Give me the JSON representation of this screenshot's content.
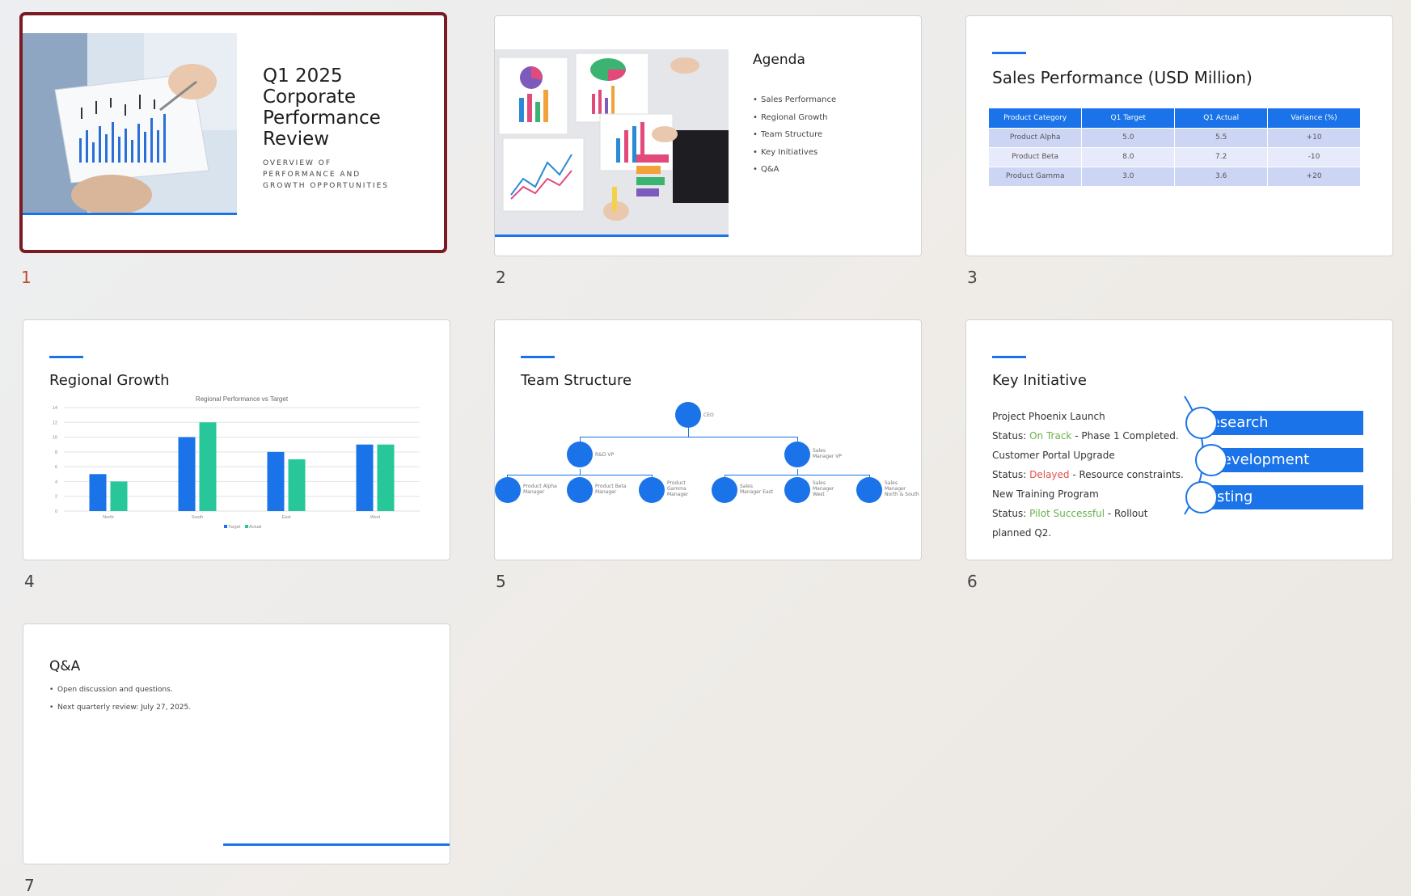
{
  "slides": [
    {
      "number": "1",
      "selected": true,
      "title": "Q1 2025\nCorporate\nPerformance\nReview",
      "subtitle": "OVERVIEW OF\nPERFORMANCE AND\nGROWTH OPPORTUNITIES"
    },
    {
      "number": "2",
      "title": "Agenda",
      "items": [
        "Sales Performance",
        "Regional Growth",
        "Team Structure",
        "Key Initiatives",
        "Q&A"
      ]
    },
    {
      "number": "3",
      "title": "Sales Performance (USD Million)",
      "table": {
        "headers": [
          "Product Category",
          "Q1 Target",
          "Q1 Actual",
          "Variance (%)"
        ],
        "rows": [
          [
            "Product Alpha",
            "5.0",
            "5.5",
            "+10"
          ],
          [
            "Product Beta",
            "8.0",
            "7.2",
            "-10"
          ],
          [
            "Product Gamma",
            "3.0",
            "3.6",
            "+20"
          ]
        ]
      }
    },
    {
      "number": "4",
      "title": "Regional Growth"
    },
    {
      "number": "5",
      "title": "Team Structure",
      "org": {
        "ceo": "CEO",
        "rd_vp": "R&D VP",
        "sales_vp": "Sales\nManager VP",
        "alpha": "Product Alpha\nManager",
        "beta": "Product Beta\nManager",
        "gamma": "Product\nGamma\nManager",
        "east": "Sales\nManager East",
        "west": "Sales\nManager\nWest",
        "north_south": "Sales\nManager\nNorth & South"
      }
    },
    {
      "number": "6",
      "title": "Key Initiative",
      "initiatives": [
        {
          "name": "Project Phoenix Launch",
          "status_label": "Status: ",
          "status": "On Track",
          "note": " - Phase 1 Completed."
        },
        {
          "name": "Customer Portal Upgrade",
          "status_label": "Status: ",
          "status": "Delayed",
          "note": " - Resource constraints."
        },
        {
          "name": "New Training Program",
          "status_label": "Status: ",
          "status": "Pilot Successful",
          "note": " - Rollout",
          "note2": "planned Q2."
        }
      ],
      "phases": [
        "Research",
        "Development",
        "Testing"
      ]
    },
    {
      "number": "7",
      "title": "Q&A",
      "items": [
        "Open discussion and questions.",
        "Next quarterly review: July 27, 2025."
      ]
    }
  ],
  "chart_data": {
    "type": "bar",
    "title": "Regional Performance vs Target",
    "categories": [
      "North",
      "South",
      "East",
      "West"
    ],
    "series": [
      {
        "name": "Target",
        "values": [
          5,
          10,
          8,
          9
        ],
        "color": "#1a73e8"
      },
      {
        "name": "Actual",
        "values": [
          4,
          12,
          7,
          9
        ],
        "color": "#27c79a"
      }
    ],
    "ylim": [
      0,
      14
    ],
    "yticks": [
      0,
      2,
      4,
      6,
      8,
      10,
      12,
      14
    ],
    "grid": true,
    "legend": "bottom"
  },
  "colors": {
    "accent": "#1a73e8",
    "secondary": "#27c79a",
    "selection": "#7a1a22"
  }
}
